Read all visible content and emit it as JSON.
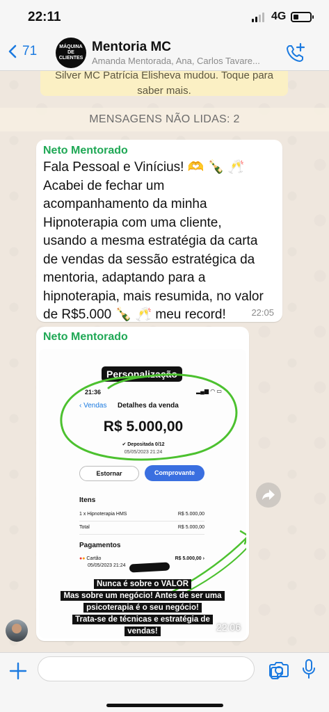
{
  "status_bar": {
    "time": "22:11",
    "network": "4G",
    "battery_percent": 30
  },
  "header": {
    "back_count": "71",
    "avatar_text": "MÁQUINA DE CLIENTES",
    "title": "Mentoria MC",
    "subtitle": "Amanda Mentorada, Ana, Carlos Tavare..."
  },
  "notice": {
    "line1": "Silver MC Patrícia Elisheva mudou. Toque para",
    "line2": "saber mais."
  },
  "unread_label": "MENSAGENS NÃO LIDAS: 2",
  "message1": {
    "sender": "Neto Mentorado",
    "text": "Fala Pessoal e Vinícius! 🫶 🍾 🥂\nAcabei de fechar um\nacompanhamento da minha\nHipnoterapia com uma cliente,\nusando a mesma estratégia da carta\nde vendas da sessão estratégica da\nmentoria, adaptando para a\nhipnoterapia, mais resumida, no valor\nde R$5.000 🍾 🥂  meu record!",
    "time": "22:05"
  },
  "message2": {
    "sender": "Neto Mentorado",
    "time": "22:06",
    "image": {
      "tag": "Personalização",
      "phone_time": "21:36",
      "back_label": "Vendas",
      "title": "Detalhes da venda",
      "amount": "R$ 5.000,00",
      "deposit": "Depositada 0/12",
      "datetime": "05/05/2023 21:24",
      "btn_estornar": "Estornar",
      "btn_comprovante": "Comprovante",
      "items_title": "Itens",
      "item_name": "1 x Hipnoterapia HMS",
      "item_value": "R$ 5.000,00",
      "total_label": "Total",
      "total_value": "R$ 5.000,00",
      "payments_title": "Pagamentos",
      "payment_method": "Cartão",
      "payment_date": "05/05/2023 21:24",
      "payment_value": "R$ 5.000,00",
      "caption": [
        "Nunca é sobre o VALOR",
        "Mas sobre um negócio! Antes de ser uma",
        "psicoterapia é o seu negócio!",
        "Trata-se de técnicas e estratégia de",
        "vendas!"
      ]
    }
  },
  "colors": {
    "accent": "#1b7ae0",
    "sender": "#1fa855",
    "highlight": "#4cc12f"
  }
}
